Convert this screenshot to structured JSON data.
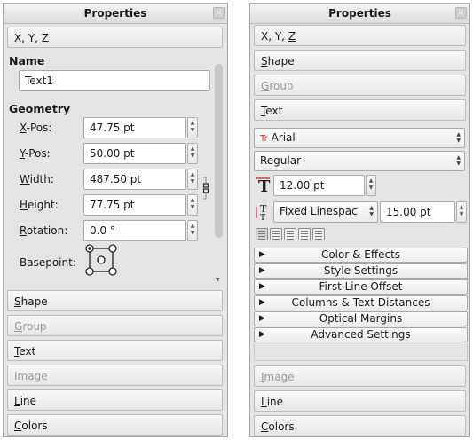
{
  "left_panel": {
    "title": "Properties",
    "close_glyph": "×",
    "sections_top": [
      "X, Y, Z"
    ],
    "name": {
      "heading": "Name",
      "value": "Text1"
    },
    "geometry": {
      "heading": "Geometry",
      "fields": [
        {
          "underline": "X",
          "rest": "-Pos:",
          "value": "47.75 pt"
        },
        {
          "underline": "Y",
          "rest": "-Pos:",
          "value": "50.00 pt"
        },
        {
          "underline": "W",
          "rest": "idth:",
          "value": "487.50 pt"
        },
        {
          "underline": "H",
          "rest": "eight:",
          "value": "77.75 pt"
        },
        {
          "underline": "R",
          "rest": "otation:",
          "value": "0.0 °"
        }
      ],
      "basepoint_label": "Basepoint:"
    },
    "sections_bottom": [
      {
        "label": "Shape",
        "underline": "S",
        "rest": "hape",
        "disabled": false
      },
      {
        "label": "Group",
        "underline": "G",
        "rest": "roup",
        "disabled": true
      },
      {
        "label": "Text",
        "underline": "T",
        "rest": "ext",
        "disabled": false
      },
      {
        "label": "Image",
        "underline": "I",
        "rest": "mage",
        "disabled": true
      },
      {
        "label": "Line",
        "underline": "L",
        "rest": "ine",
        "disabled": false
      },
      {
        "label": "Colors",
        "underline": "C",
        "rest": "olors",
        "disabled": false
      }
    ]
  },
  "right_panel": {
    "title": "Properties",
    "close_glyph": "×",
    "sections_top": [
      {
        "pre": "X, Y, ",
        "underline": "Z",
        "rest": "",
        "disabled": false
      },
      {
        "pre": "",
        "underline": "S",
        "rest": "hape",
        "disabled": false
      },
      {
        "pre": "",
        "underline": "G",
        "rest": "roup",
        "disabled": true
      },
      {
        "pre": "",
        "underline": "T",
        "rest": "ext",
        "disabled": false
      }
    ],
    "text": {
      "font": "Arial",
      "font_icon": "Tr",
      "style": "Regular",
      "font_size": "12.00 pt",
      "linespacing_mode": "Fixed Linespac",
      "linespacing_value": "15.00 pt",
      "expanders": [
        "Color & Effects",
        "Style Settings",
        "First Line Offset",
        "Columns & Text Distances",
        "Optical Margins",
        "Advanced Settings"
      ]
    },
    "sections_bottom": [
      {
        "underline": "I",
        "rest": "mage",
        "disabled": true
      },
      {
        "underline": "L",
        "rest": "ine",
        "disabled": false
      },
      {
        "underline": "C",
        "rest": "olors",
        "disabled": false
      }
    ]
  },
  "colors": {
    "panel": "#e4e4e4",
    "accent": "#c0392b",
    "disabled_text": "#9a9a9a"
  }
}
